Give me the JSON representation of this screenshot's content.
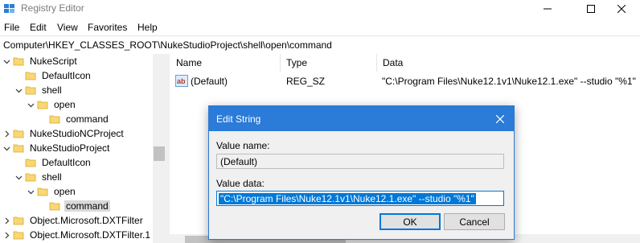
{
  "window": {
    "title": "Registry Editor"
  },
  "menu": [
    "File",
    "Edit",
    "View",
    "Favorites",
    "Help"
  ],
  "address": "Computer\\HKEY_CLASSES_ROOT\\NukeStudioProject\\shell\\open\\command",
  "tree": [
    {
      "label": "NukeScript",
      "expanded": true
    },
    {
      "label": "DefaultIcon",
      "expanded": null
    },
    {
      "label": "shell",
      "expanded": true
    },
    {
      "label": "open",
      "expanded": true
    },
    {
      "label": "command",
      "expanded": null
    },
    {
      "label": "NukeStudioNCProject",
      "expanded": false
    },
    {
      "label": "NukeStudioProject",
      "expanded": true
    },
    {
      "label": "DefaultIcon",
      "expanded": null
    },
    {
      "label": "shell",
      "expanded": true
    },
    {
      "label": "open",
      "expanded": true
    },
    {
      "label": "command",
      "expanded": null,
      "selected": true
    },
    {
      "label": "Object.Microsoft.DXTFilter",
      "expanded": false
    },
    {
      "label": "Object.Microsoft.DXTFilter.1",
      "expanded": false
    }
  ],
  "list": {
    "columns": [
      "Name",
      "Type",
      "Data"
    ],
    "rows": [
      {
        "name": "(Default)",
        "type": "REG_SZ",
        "data": "\"C:\\Program Files\\Nuke12.1v1\\Nuke12.1.exe\" --studio \"%1\""
      }
    ]
  },
  "dialog": {
    "title": "Edit String",
    "value_name_label": "Value name:",
    "value_name": "(Default)",
    "value_data_label": "Value data:",
    "value_data": "\"C:\\Program Files\\Nuke12.1v1\\Nuke12.1.exe\" --studio \"%1\"",
    "ok": "OK",
    "cancel": "Cancel"
  }
}
